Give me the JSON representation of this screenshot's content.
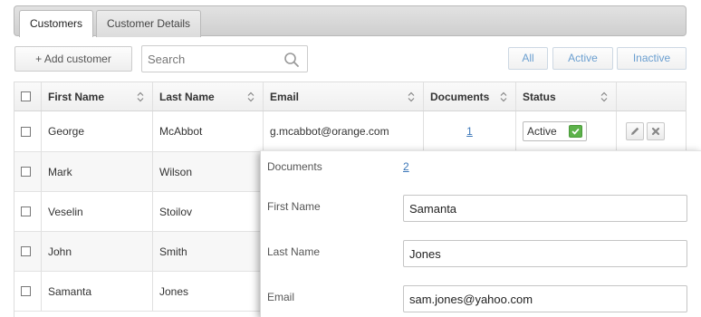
{
  "tabs": [
    {
      "label": "Customers",
      "active": true
    },
    {
      "label": "Customer Details",
      "active": false
    }
  ],
  "toolbar": {
    "add_label": "+ Add customer",
    "search_placeholder": "Search",
    "filters": [
      "All",
      "Active",
      "Inactive"
    ]
  },
  "grid": {
    "columns": [
      "First Name",
      "Last Name",
      "Email",
      "Documents",
      "Status"
    ],
    "rows": [
      {
        "first": "George",
        "last": "McAbbot",
        "email": "g.mcabbot@orange.com",
        "documents": "1",
        "status": "Active"
      },
      {
        "first": "Mark",
        "last": "Wilson"
      },
      {
        "first": "Veselin",
        "last": "Stoilov"
      },
      {
        "first": "John",
        "last": "Smith"
      },
      {
        "first": "Samanta",
        "last": "Jones"
      }
    ]
  },
  "popup": {
    "documents_label": "Documents",
    "documents_value": "2",
    "first_name_label": "First Name",
    "first_name_value": "Samanta",
    "last_name_label": "Last Name",
    "last_name_value": "Jones",
    "email_label": "Email",
    "email_value": "sam.jones@yahoo.com"
  },
  "colors": {
    "link": "#3b77b8",
    "filter_text": "#6b9fd0",
    "status_check": "#5cb24a"
  }
}
